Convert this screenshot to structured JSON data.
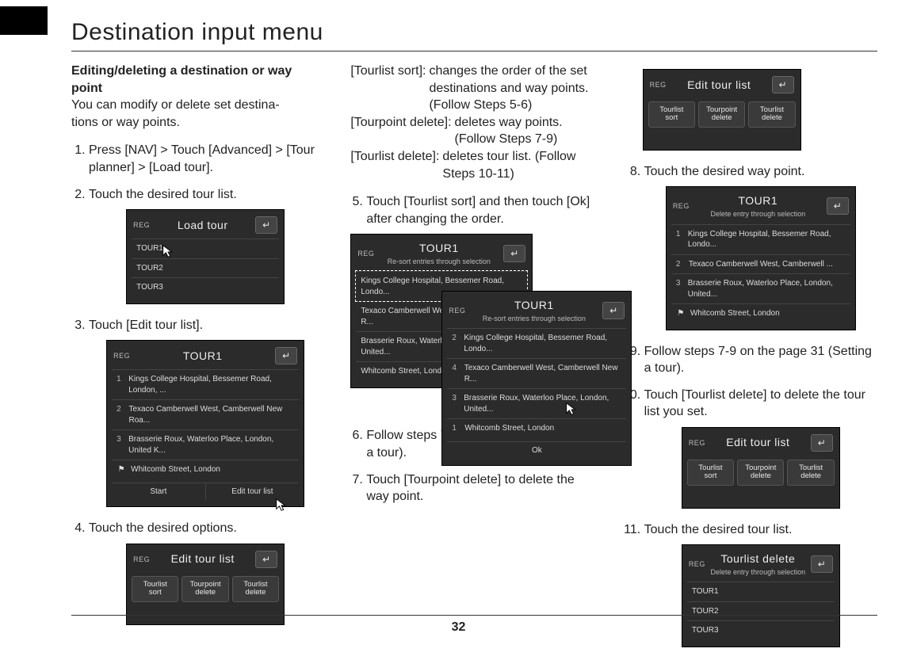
{
  "page_title": "Destination input menu",
  "page_number": "32",
  "col1": {
    "subhead": "Editing/deleting a destination or way point",
    "intro": "You can modify or delete set destina-\ntions or way points.",
    "steps": {
      "s1": "Press [NAV] > Touch [Advanced] > [Tour planner] > [Load tour].",
      "s2": "Touch the desired tour list.",
      "s3": "Touch [Edit tour list].",
      "s4": "Touch the desired options."
    }
  },
  "col2": {
    "opts": {
      "a_label": "[Tourlist sort]:",
      "a_text": "changes the order of the set destinations and way points. (Follow Steps 5-6)",
      "b_label": "[Tourpoint delete]:",
      "b_text": "deletes way points. (Follow Steps 7-9)",
      "c_label": "[Tourlist delete]:",
      "c_text": "deletes tour list. (Follow Steps 10-11)"
    },
    "steps": {
      "s5": "Touch [Tourlist sort] and then touch [Ok] after changing the order.",
      "s6": "Follow steps 7-9 on the page 31 (Setting a tour).",
      "s7": "Touch [Tourpoint delete] to delete the way point."
    }
  },
  "col3": {
    "steps": {
      "s8": "Touch the desired way point.",
      "s9": "Follow steps 7-9 on the page 31 (Setting a tour).",
      "s10": "Touch [Tourlist delete] to delete the tour list you set.",
      "s11": "Touch the desired tour list."
    }
  },
  "dev_common": {
    "reg": "REG",
    "back": "↵"
  },
  "dev_load_tour": {
    "title": "Load tour",
    "rows": [
      "TOUR1",
      "TOUR2",
      "TOUR3"
    ]
  },
  "dev_tour1": {
    "title": "TOUR1",
    "rows": [
      {
        "n": "1",
        "t": "Kings College Hospital, Bessemer Road, London, ..."
      },
      {
        "n": "2",
        "t": "Texaco Camberwell West, Camberwell New Roa..."
      },
      {
        "n": "3",
        "t": "Brasserie Roux, Waterloo Place, London, United K..."
      },
      {
        "n": "",
        "flag": "⚑",
        "t": "Whitcomb Street, London"
      }
    ],
    "foot_left": "Start",
    "foot_right": "Edit tour list"
  },
  "dev_edit_tour_list": {
    "title": "Edit tour list",
    "btns": [
      "Tourlist\nsort",
      "Tourpoint\ndelete",
      "Tourlist\ndelete"
    ]
  },
  "dev_sort_a": {
    "title": "TOUR1",
    "sub": "Re-sort entries through selection",
    "rows": [
      "Kings College Hospital, Bessemer Road, Londo...",
      "Texaco Camberwell West, Camberwell New R...",
      "Brasserie Roux, Waterloo Place, London, United...",
      "Whitcomb Street, London"
    ]
  },
  "dev_sort_b": {
    "title": "TOUR1",
    "sub": "Re-sort entries through selection",
    "rows": [
      {
        "n": "2",
        "t": "Kings College Hospital, Bessemer Road, Londo..."
      },
      {
        "n": "4",
        "t": "Texaco Camberwell West, Camberwell New R..."
      },
      {
        "n": "3",
        "t": "Brasserie Roux, Waterloo Place, London, United..."
      },
      {
        "n": "1",
        "t": "Whitcomb Street, London"
      }
    ],
    "ok": "Ok"
  },
  "dev_delete_waypoint": {
    "title": "TOUR1",
    "sub": "Delete entry through selection",
    "rows": [
      {
        "n": "1",
        "t": "Kings College Hospital, Bessemer Road, Londo..."
      },
      {
        "n": "2",
        "t": "Texaco Camberwell West, Camberwell ..."
      },
      {
        "n": "3",
        "t": "Brasserie Roux, Waterloo Place, London, United..."
      },
      {
        "n": "",
        "flag": "⚑",
        "t": "Whitcomb Street, London"
      }
    ]
  },
  "dev_tourlist_delete": {
    "title": "Tourlist delete",
    "sub": "Delete entry through selection",
    "rows": [
      "TOUR1",
      "TOUR2",
      "TOUR3"
    ]
  }
}
